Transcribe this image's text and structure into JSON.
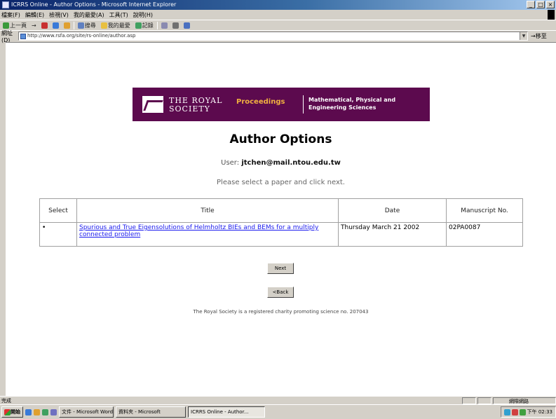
{
  "window": {
    "title": "ICRRS Online - Author Options - Microsoft Internet Explorer"
  },
  "menu": [
    "檔案(F)",
    "編輯(E)",
    "檢視(V)",
    "我的最愛(A)",
    "工具(T)",
    "說明(H)"
  ],
  "toolbar": {
    "back": "上一頁",
    "forward": "→",
    "search": "搜尋",
    "favorites": "我的最愛",
    "history": "記錄"
  },
  "address": {
    "label": "網址(D)",
    "url": "http://www.rsfa.org/site/rs-online/author.asp",
    "go": "→移至"
  },
  "banner": {
    "org_line1": "THE ROYAL",
    "org_line2": "SOCIETY",
    "journal": "Proceedings",
    "subject_line1": "Mathematical, Physical and",
    "subject_line2": "Engineering Sciences"
  },
  "page": {
    "title": "Author Options",
    "user_label": "User:",
    "user_email": "jtchen@mail.ntou.edu.tw",
    "instruction": "Please select a paper and click next.",
    "next_button": "Next",
    "back_button": "<Back",
    "footer": "The Royal Society is a registered charity promoting science no. 207043"
  },
  "table": {
    "headers": {
      "select": "Select",
      "title": "Title",
      "date": "Date",
      "manuscript": "Manuscript No."
    },
    "rows": [
      {
        "select": "•",
        "title": "Spurious and True Eigensolutions of Helmholtz BIEs and BEMs for a multiply connected problem",
        "date": "Thursday March 21 2002",
        "manuscript": "02PA0087"
      }
    ]
  },
  "statusbar": {
    "status": "完成",
    "zone": "網際網路"
  },
  "taskbar": {
    "start": "開始",
    "tasks": [
      "文件 - Microsoft Word",
      "資料夾 - Microsoft",
      "ICRRS Online - Author..."
    ],
    "clock": "下午 02:33"
  }
}
